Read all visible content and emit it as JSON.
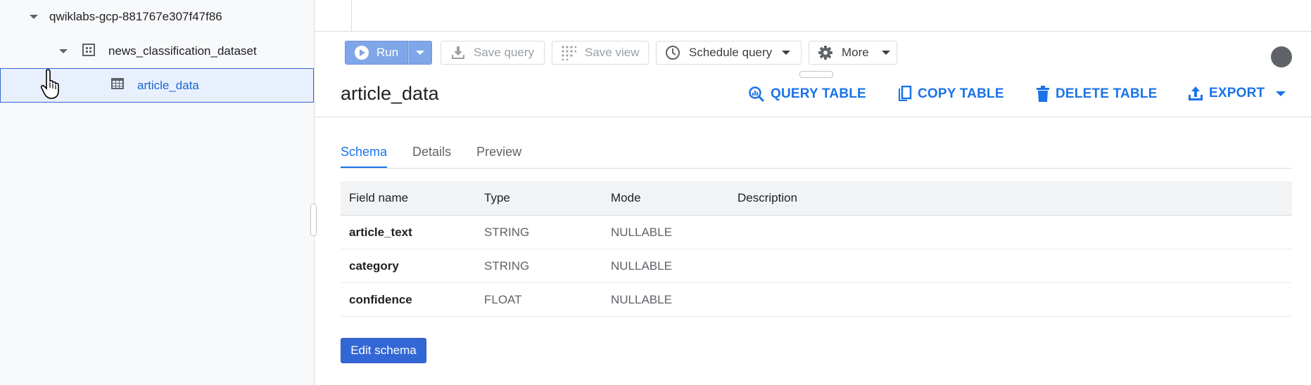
{
  "explorer": {
    "project": "qwiklabs-gcp-881767e307f47f86",
    "dataset": "news_classification_dataset",
    "table": "article_data"
  },
  "toolbar": {
    "run_label": "Run",
    "save_query_label": "Save query",
    "save_view_label": "Save view",
    "schedule_label": "Schedule query",
    "more_label": "More"
  },
  "header": {
    "title": "article_data",
    "actions": {
      "query_table": "QUERY TABLE",
      "copy_table": "COPY TABLE",
      "delete_table": "DELETE TABLE",
      "export": "EXPORT"
    }
  },
  "tabs": [
    {
      "label": "Schema",
      "active": true
    },
    {
      "label": "Details",
      "active": false
    },
    {
      "label": "Preview",
      "active": false
    }
  ],
  "schema": {
    "columns": [
      "Field name",
      "Type",
      "Mode",
      "Description"
    ],
    "rows": [
      {
        "name": "article_text",
        "type": "STRING",
        "mode": "NULLABLE",
        "description": ""
      },
      {
        "name": "category",
        "type": "STRING",
        "mode": "NULLABLE",
        "description": ""
      },
      {
        "name": "confidence",
        "type": "FLOAT",
        "mode": "NULLABLE",
        "description": ""
      }
    ]
  },
  "edit_schema_label": "Edit schema",
  "colors": {
    "accent": "#1a73e8",
    "run_button": "#7fa6e8",
    "selected_row": "#e8f0fe",
    "primary_button": "#3367d6"
  },
  "icons": {
    "run": "play-circle-icon",
    "save_query": "download-icon",
    "save_view": "grid-dots-icon",
    "schedule": "clock-icon",
    "more": "gear-icon",
    "query_table": "query-search-icon",
    "copy_table": "copy-icon",
    "delete_table": "trash-icon",
    "export": "upload-icon",
    "dataset": "dataset-icon",
    "table": "table-icon"
  }
}
